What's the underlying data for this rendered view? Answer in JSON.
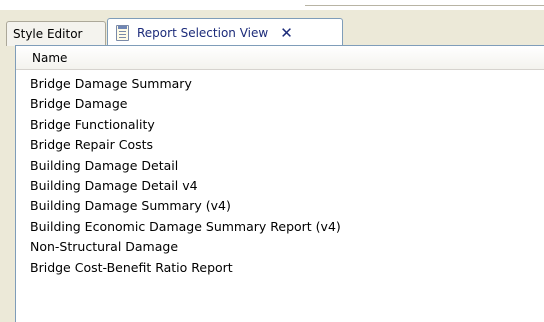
{
  "tabs": [
    {
      "label": "Style Editor"
    },
    {
      "label": "Report Selection View",
      "icon": "report-document-icon",
      "close_icon": "close-icon",
      "close_glyph": "✕"
    }
  ],
  "table": {
    "header": "Name",
    "rows": [
      "Bridge Damage Summary",
      "Bridge Damage",
      "Bridge Functionality",
      "Bridge Repair Costs",
      "Building Damage Detail",
      "Building Damage Detail v4",
      "Building Damage Summary (v4)",
      "Building Economic Damage Summary Report (v4)",
      "Non-Structural Damage",
      "Bridge Cost-Benefit Ratio Report"
    ]
  },
  "colors": {
    "active_tab_text": "#1c2b7a",
    "window_bg": "#ece9d8",
    "list_bg": "#ffffff"
  }
}
